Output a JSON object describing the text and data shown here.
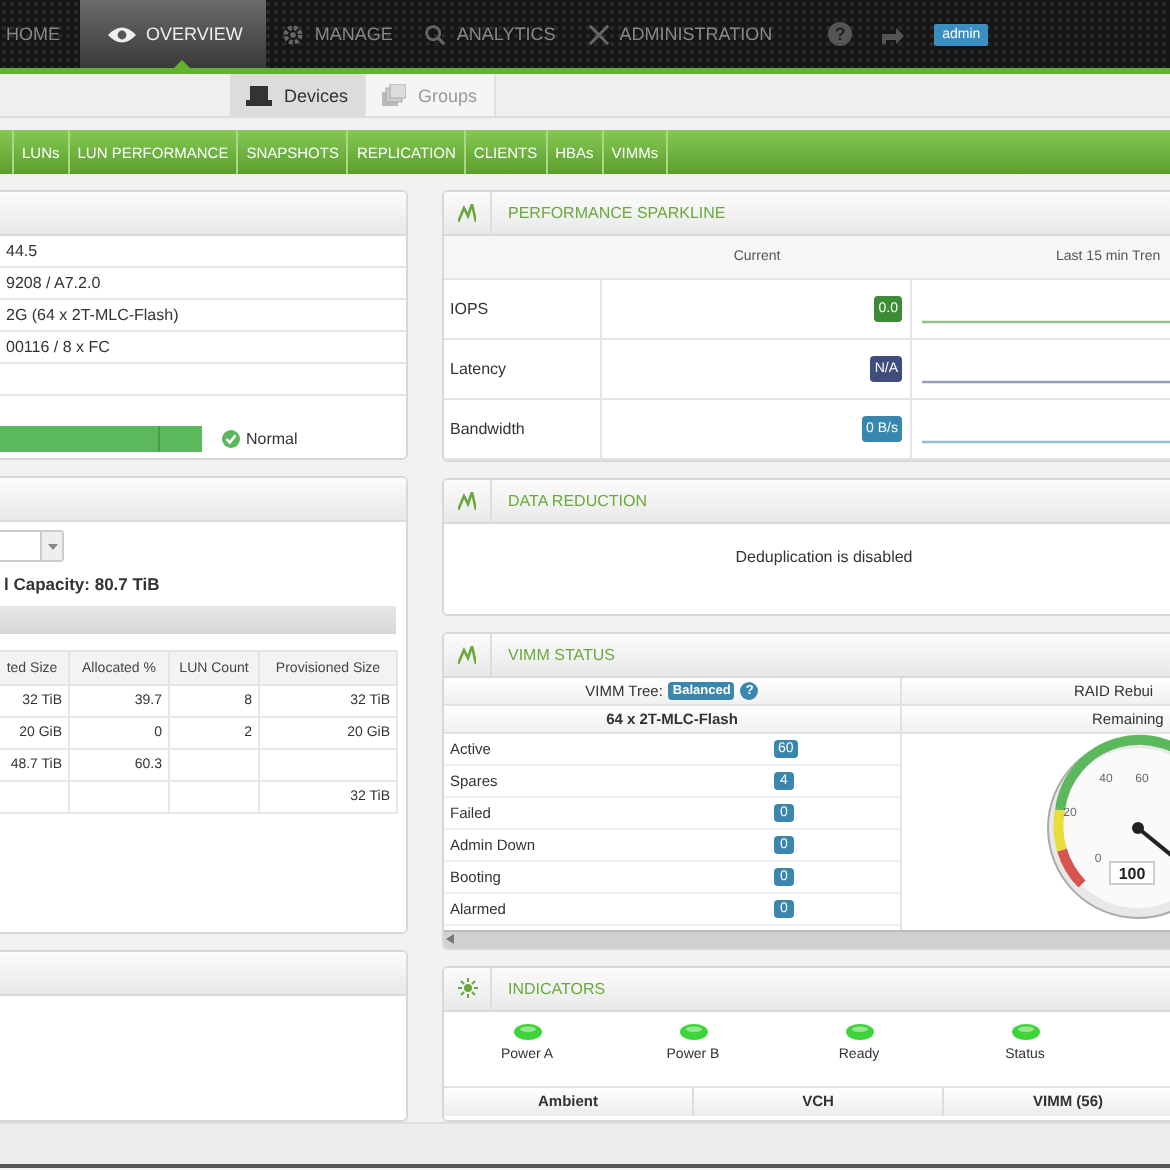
{
  "nav": {
    "items": [
      {
        "label": "HOME",
        "kind": "home",
        "selected": false
      },
      {
        "label": "OVERVIEW",
        "kind": "overview",
        "selected": true
      },
      {
        "label": "MANAGE",
        "kind": "manage",
        "selected": false
      },
      {
        "label": "ANALYTICS",
        "kind": "analytics",
        "selected": false
      },
      {
        "label": "ADMINISTRATION",
        "kind": "administration",
        "selected": false
      }
    ],
    "help": "?",
    "user": "admin"
  },
  "subnav": {
    "tabs": [
      {
        "label": "Devices",
        "kind": "devices",
        "selected": true
      },
      {
        "label": "Groups",
        "kind": "groups",
        "selected": false
      }
    ]
  },
  "section_tabs": [
    "LUNs",
    "LUN PERFORMANCE",
    "SNAPSHOTS",
    "REPLICATION",
    "CLIENTS",
    "HBAs",
    "VIMMs"
  ],
  "system_panel": {
    "rows": [
      "44.5",
      "9208 / A7.2.0",
      "2G (64 x 2T-MLC-Flash)",
      "00116 / 8 x FC"
    ],
    "status": {
      "level": 1,
      "label": "Normal"
    }
  },
  "capacity_panel": {
    "total": "l Capacity: 80.7 TiB",
    "columns": [
      "ted Size",
      "Allocated %",
      "LUN Count",
      "Provisioned Size"
    ],
    "rows": [
      [
        "32 TiB",
        "39.7",
        "8",
        "32 TiB"
      ],
      [
        "20 GiB",
        "0",
        "2",
        "20 GiB"
      ],
      [
        "48.7 TiB",
        "60.3",
        null,
        null
      ],
      [
        null,
        null,
        null,
        "32 TiB"
      ]
    ]
  },
  "performance": {
    "title": "PERFORMANCE SPARKLINE",
    "columns": [
      "Current",
      "Last 15 min Tren"
    ],
    "rows": [
      {
        "label": "IOPS",
        "value": "0.0",
        "color": "#3d8b37"
      },
      {
        "label": "Latency",
        "value": "N/A",
        "color": "#3f4d7d"
      },
      {
        "label": "Bandwidth",
        "value": "0 B/s",
        "color": "#3a87ad"
      }
    ]
  },
  "data_reduction": {
    "title": "DATA REDUCTION",
    "message": "Deduplication is disabled"
  },
  "vimm_status": {
    "title": "VIMM STATUS",
    "tree_label": "VIMM Tree:",
    "tree_state": "Balanced",
    "help": "?",
    "flash": "64 x 2T-MLC-Flash",
    "raid_label": "RAID Rebui",
    "remaining_label": "Remaining",
    "rows": [
      {
        "label": "Active",
        "count": "60"
      },
      {
        "label": "Spares",
        "count": "4"
      },
      {
        "label": "Failed",
        "count": "0"
      },
      {
        "label": "Admin Down",
        "count": "0"
      },
      {
        "label": "Booting",
        "count": "0"
      },
      {
        "label": "Alarmed",
        "count": "0"
      }
    ],
    "gauge": {
      "reading": "100",
      "ticks": [
        "0",
        "20",
        "40",
        "60"
      ]
    }
  },
  "indicators": {
    "title": "INDICATORS",
    "leds": [
      {
        "label": "Power A",
        "on": true
      },
      {
        "label": "Power B",
        "on": true
      },
      {
        "label": "Ready",
        "on": true
      },
      {
        "label": "Status",
        "on": true
      }
    ],
    "columns": [
      "Ambient",
      "VCH",
      "VIMM (56)"
    ]
  }
}
